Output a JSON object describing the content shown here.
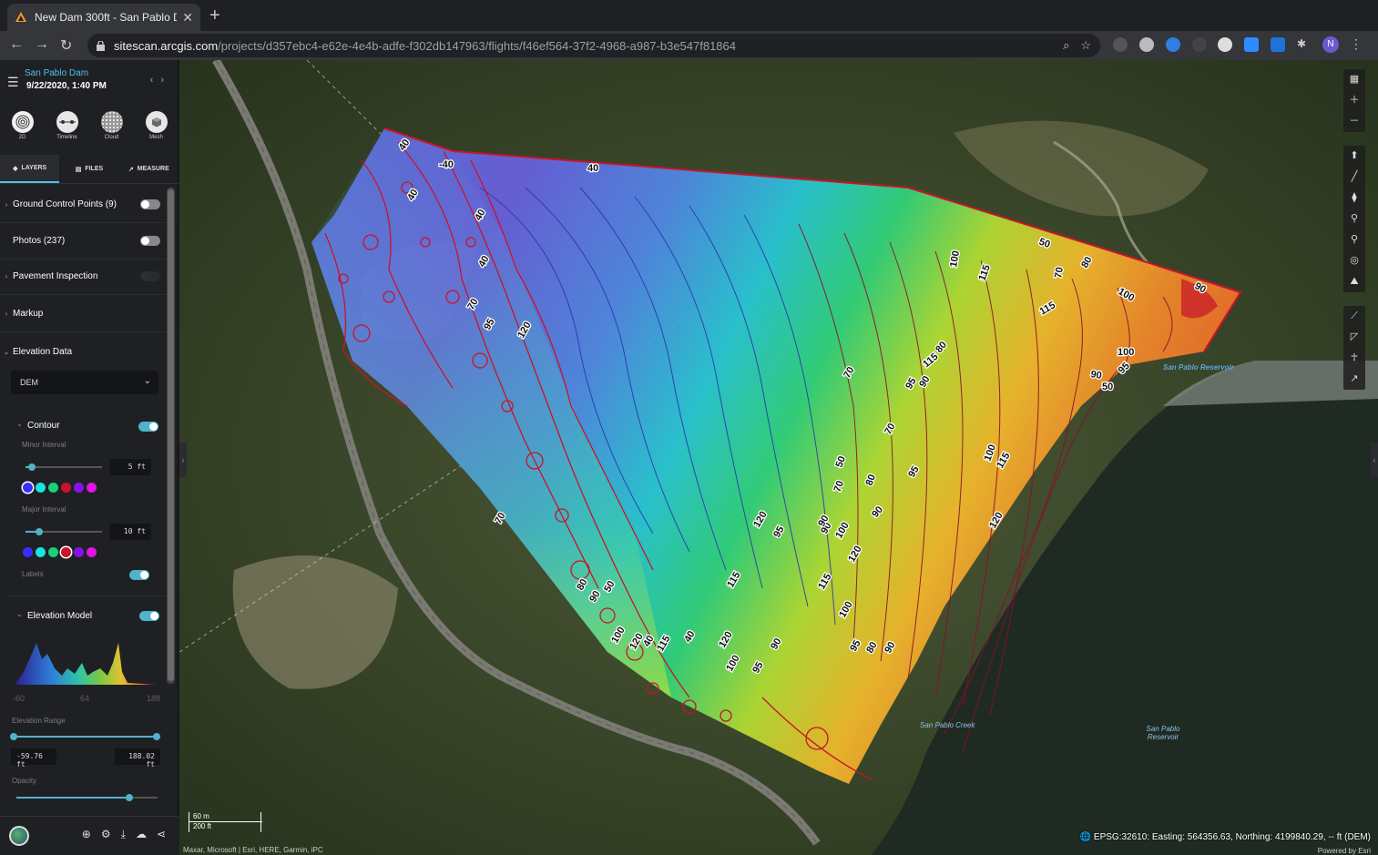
{
  "browser": {
    "tab_title": "New Dam 300ft - San Pablo Da",
    "url_host": "sitescan.arcgis.com",
    "url_path": "/projects/d357ebc4-e62e-4e4b-adfe-f302db147963/flights/f46ef564-37f2-4968-a987-b3e547f81864",
    "profile_initial": "N"
  },
  "project": {
    "name": "San Pablo Dam",
    "date": "9/22/2020, 1:40 PM"
  },
  "views": [
    "2D",
    "Timeline",
    "Cloud",
    "Mesh"
  ],
  "panel_tabs": [
    "LAYERS",
    "FILES",
    "MEASURE"
  ],
  "layers": [
    {
      "label": "Ground Control Points (9)",
      "expandable": true
    },
    {
      "label": "Photos (237)",
      "expandable": false
    },
    {
      "label": "Pavement Inspection",
      "expandable": true
    },
    {
      "label": "Markup",
      "expandable": true
    },
    {
      "label": "Elevation Data",
      "expandable": true
    }
  ],
  "elevation": {
    "dataset": "DEM",
    "contour_title": "Contour",
    "minor_interval_label": "Minor Interval",
    "minor_interval_value": "5 ft",
    "major_interval_label": "Major Interval",
    "major_interval_value": "10 ft",
    "labels_label": "Labels",
    "model_title": "Elevation Model",
    "hist_min": "-60",
    "hist_mid": "64",
    "hist_max": "188",
    "range_label": "Elevation Range",
    "range_min": "-59.76 ft",
    "range_max": "188.02 ft",
    "opacity_label": "Opacity",
    "opacity_value": 0.8,
    "minor_slider": 0.08,
    "major_slider": 0.18
  },
  "colors": {
    "accent": "#4fb3c9",
    "swatches_minor": [
      "#3b2cff",
      "#19e3e3",
      "#15d27a",
      "#c8142a",
      "#8b10f0",
      "#e611e6"
    ],
    "swatches_major": [
      "#3b2cff",
      "#19e3e3",
      "#15d27a",
      "#c8142a",
      "#8b10f0",
      "#e611e6"
    ]
  },
  "map": {
    "scale_metric": "60 m",
    "scale_imperial": "200 ft",
    "coords": "EPSG:32610: Easting: 564356.63, Northing: 4199840.29, -- ft (DEM)",
    "attribution": "Maxar, Microsoft | Esri, HERE, Garmin, iPC",
    "powered": "Powered by Esri",
    "place_labels": [
      "San Pablo Reservoir",
      "San Pablo Creek",
      "San Pablo Reservoir"
    ],
    "contour_labels": [
      "40",
      "-40",
      "40",
      "40",
      "40",
      "40",
      "70",
      "95",
      "120",
      "50",
      "80",
      "90",
      "100",
      "115",
      "70",
      "100",
      "115",
      "100",
      "95",
      "90",
      "50",
      "70",
      "80",
      "90",
      "95",
      "115",
      "70",
      "100",
      "120",
      "115",
      "50",
      "70",
      "80",
      "90",
      "95",
      "100",
      "120",
      "95",
      "90",
      "90",
      "120",
      "115",
      "100",
      "95",
      "90",
      "80",
      "90",
      "95",
      "100",
      "120",
      "115",
      "40",
      "50",
      "70",
      "80",
      "90",
      "100",
      "120",
      "115"
    ]
  }
}
